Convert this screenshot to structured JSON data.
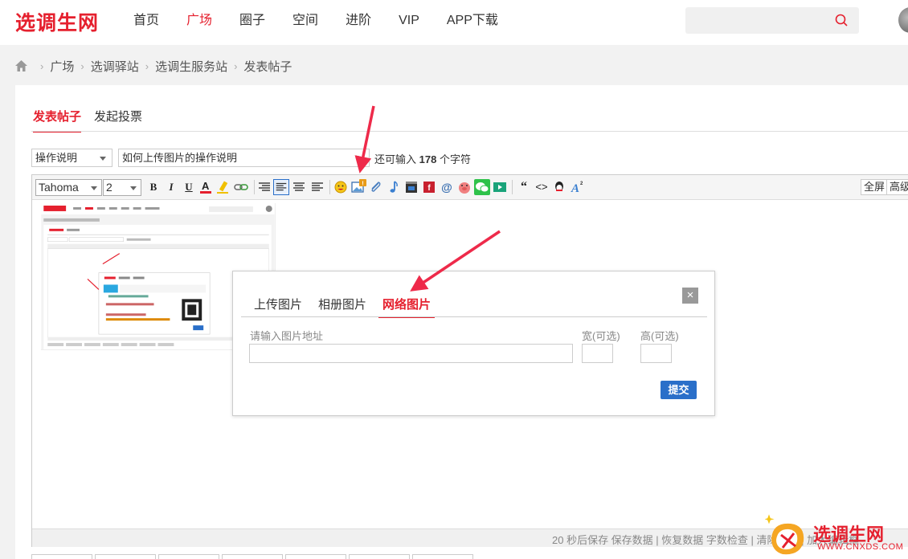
{
  "site": {
    "logo": "选调生网"
  },
  "nav": {
    "items": [
      {
        "label": "首页",
        "active": false
      },
      {
        "label": "广场",
        "active": true
      },
      {
        "label": "圈子",
        "active": false
      },
      {
        "label": "空间",
        "active": false
      },
      {
        "label": "进阶",
        "active": false
      },
      {
        "label": "VIP",
        "active": false
      },
      {
        "label": "APP下载",
        "active": false
      }
    ],
    "search_placeholder": ""
  },
  "breadcrumb": [
    "广场",
    "选调驿站",
    "选调生服务站",
    "发表帖子"
  ],
  "post_tabs": {
    "publish": "发表帖子",
    "vote": "发起投票"
  },
  "form": {
    "type_value": "操作说明",
    "title_value": "如何上传图片的操作说明",
    "counter_prefix": "还可输入",
    "counter_number": "178",
    "counter_suffix": "个字符"
  },
  "toolbar": {
    "font": "Tahoma",
    "size": "2",
    "bold": "B",
    "italic": "I",
    "underline": "U",
    "quote": "“",
    "code": "<>",
    "fullscreen": "全屏",
    "advanced": "高级"
  },
  "status": {
    "text": "20 秒后保存 保存数据 | 恢复数据    字数检查 | 清除内容 | 加大编辑框"
  },
  "dialog": {
    "tabs": [
      "上传图片",
      "相册图片",
      "网络图片"
    ],
    "active_tab": 2,
    "close": "×",
    "url_label": "请输入图片地址",
    "width_label": "宽(可选)",
    "height_label": "高(可选)",
    "submit": "提交"
  },
  "watermark": {
    "text": "选调生网",
    "url": "WWW.CNXDS.COM"
  },
  "colors": {
    "brand_red": "#e5202e",
    "primary_blue": "#2a6fc9"
  }
}
